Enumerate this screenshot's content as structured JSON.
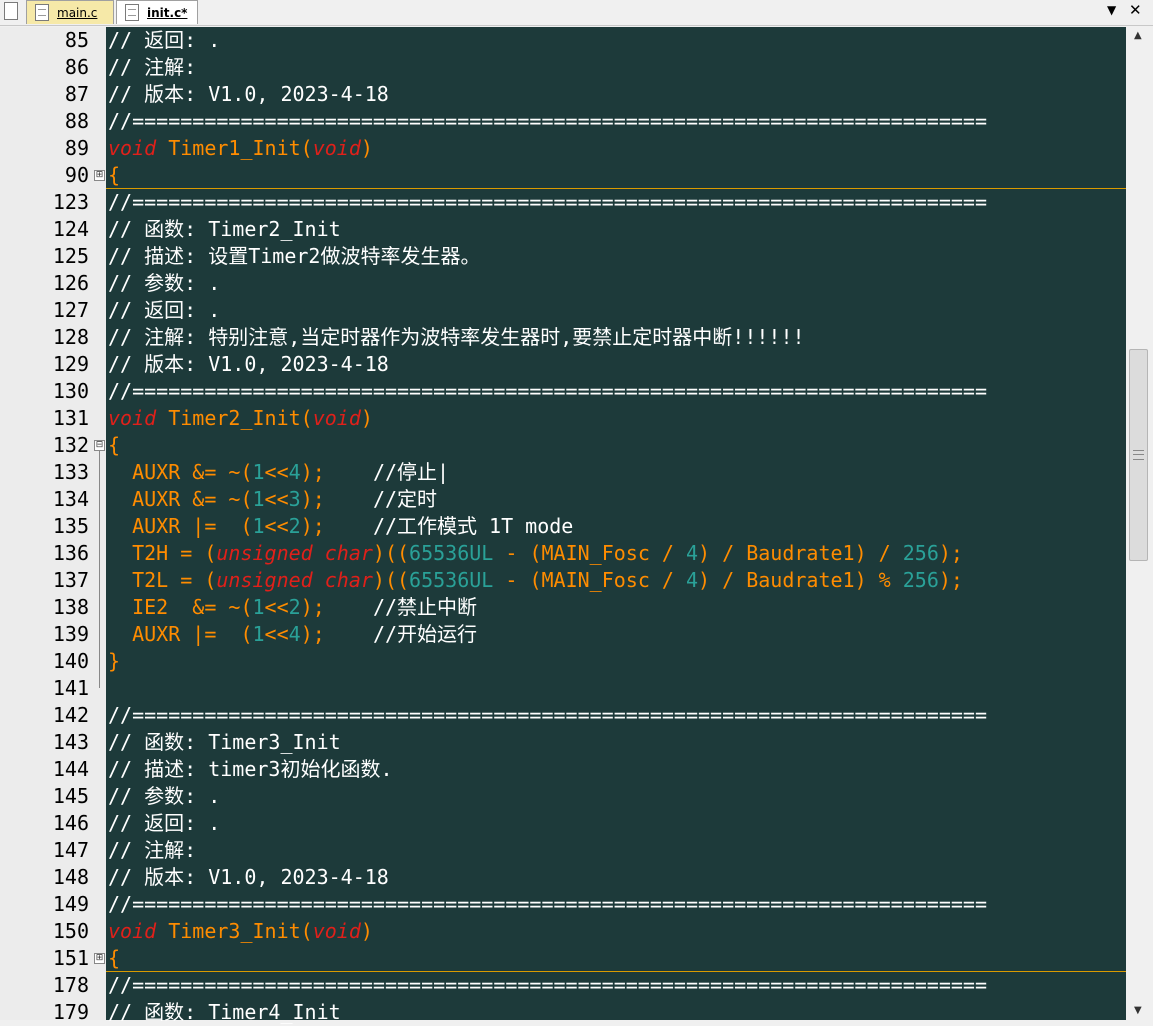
{
  "tabs": [
    {
      "label": "main.c"
    },
    {
      "label": "init.c*"
    }
  ],
  "icons": {
    "dropdown": "chevron-down-icon",
    "close": "close-icon",
    "file": "file-icon"
  },
  "glyphs": {
    "dropdown": "▼",
    "close": "✕",
    "fold_collapsed": "⊞",
    "fold_expanded": "⊟",
    "scroll_up": "▲",
    "scroll_down": "▼"
  },
  "colors": {
    "editor_bg": "#1d3a3a",
    "keyword": "#e0201a",
    "identifier": "#ff8c00",
    "number": "#2aa198",
    "comment": "#ffffff"
  },
  "code_lines": [
    {
      "n": "85",
      "tokens": [
        [
          "cm",
          "// 返回: ."
        ]
      ]
    },
    {
      "n": "86",
      "tokens": [
        [
          "cm",
          "// 注解:"
        ]
      ]
    },
    {
      "n": "87",
      "tokens": [
        [
          "cm",
          "// 版本: V1.0, 2023-4-18"
        ]
      ]
    },
    {
      "n": "88",
      "tokens": [
        [
          "cm",
          "//======================================================================="
        ]
      ]
    },
    {
      "n": "89",
      "tokens": [
        [
          "kw",
          "void"
        ],
        [
          "fn",
          " Timer1_Init("
        ],
        [
          "kw",
          "void"
        ],
        [
          "fn",
          ")"
        ]
      ]
    },
    {
      "n": "90",
      "fold": "collapsed",
      "sep_after": true,
      "tokens": [
        [
          "tx",
          "{"
        ]
      ]
    },
    {
      "n": "123",
      "tokens": [
        [
          "cm",
          "//======================================================================="
        ]
      ]
    },
    {
      "n": "124",
      "tokens": [
        [
          "cm",
          "// 函数: Timer2_Init"
        ]
      ]
    },
    {
      "n": "125",
      "tokens": [
        [
          "cm",
          "// 描述: 设置Timer2做波特率发生器。"
        ]
      ]
    },
    {
      "n": "126",
      "tokens": [
        [
          "cm",
          "// 参数: ."
        ]
      ]
    },
    {
      "n": "127",
      "tokens": [
        [
          "cm",
          "// 返回: ."
        ]
      ]
    },
    {
      "n": "128",
      "tokens": [
        [
          "cm",
          "// 注解: 特别注意,当定时器作为波特率发生器时,要禁止定时器中断!!!!!!"
        ]
      ]
    },
    {
      "n": "129",
      "tokens": [
        [
          "cm",
          "// 版本: V1.0, 2023-4-18"
        ]
      ]
    },
    {
      "n": "130",
      "tokens": [
        [
          "cm",
          "//======================================================================="
        ]
      ]
    },
    {
      "n": "131",
      "tokens": [
        [
          "kw",
          "void"
        ],
        [
          "fn",
          " Timer2_Init("
        ],
        [
          "kw",
          "void"
        ],
        [
          "fn",
          ")"
        ]
      ]
    },
    {
      "n": "132",
      "fold": "expanded",
      "tokens": [
        [
          "tx",
          "{"
        ]
      ]
    },
    {
      "n": "133",
      "tokens": [
        [
          "tx",
          "  AUXR &= ~("
        ],
        [
          "nm",
          "1"
        ],
        [
          "tx",
          "<<"
        ],
        [
          "nm",
          "4"
        ],
        [
          "tx",
          ");    "
        ],
        [
          "cm",
          "//停止|"
        ]
      ]
    },
    {
      "n": "134",
      "tokens": [
        [
          "tx",
          "  AUXR &= ~("
        ],
        [
          "nm",
          "1"
        ],
        [
          "tx",
          "<<"
        ],
        [
          "nm",
          "3"
        ],
        [
          "tx",
          ");    "
        ],
        [
          "cm",
          "//定时"
        ]
      ]
    },
    {
      "n": "135",
      "tokens": [
        [
          "tx",
          "  AUXR |=  ("
        ],
        [
          "nm",
          "1"
        ],
        [
          "tx",
          "<<"
        ],
        [
          "nm",
          "2"
        ],
        [
          "tx",
          ");    "
        ],
        [
          "cm",
          "//工作模式 1T mode"
        ]
      ]
    },
    {
      "n": "136",
      "tokens": [
        [
          "tx",
          "  T2H = ("
        ],
        [
          "kw",
          "unsigned char"
        ],
        [
          "tx",
          ")(("
        ],
        [
          "nm",
          "65536UL"
        ],
        [
          "tx",
          " - (MAIN_Fosc / "
        ],
        [
          "nm",
          "4"
        ],
        [
          "tx",
          ") / Baudrate1) / "
        ],
        [
          "nm",
          "256"
        ],
        [
          "tx",
          ");"
        ]
      ]
    },
    {
      "n": "137",
      "tokens": [
        [
          "tx",
          "  T2L = ("
        ],
        [
          "kw",
          "unsigned char"
        ],
        [
          "tx",
          ")(("
        ],
        [
          "nm",
          "65536UL"
        ],
        [
          "tx",
          " - (MAIN_Fosc / "
        ],
        [
          "nm",
          "4"
        ],
        [
          "tx",
          ") / Baudrate1) % "
        ],
        [
          "nm",
          "256"
        ],
        [
          "tx",
          ");"
        ]
      ]
    },
    {
      "n": "138",
      "tokens": [
        [
          "tx",
          "  IE2  &= ~("
        ],
        [
          "nm",
          "1"
        ],
        [
          "tx",
          "<<"
        ],
        [
          "nm",
          "2"
        ],
        [
          "tx",
          ");    "
        ],
        [
          "cm",
          "//禁止中断"
        ]
      ]
    },
    {
      "n": "139",
      "tokens": [
        [
          "tx",
          "  AUXR |=  ("
        ],
        [
          "nm",
          "1"
        ],
        [
          "tx",
          "<<"
        ],
        [
          "nm",
          "4"
        ],
        [
          "tx",
          ");    "
        ],
        [
          "cm",
          "//开始运行"
        ]
      ]
    },
    {
      "n": "140",
      "tokens": [
        [
          "tx",
          "}"
        ]
      ]
    },
    {
      "n": "141",
      "tokens": []
    },
    {
      "n": "142",
      "tokens": [
        [
          "cm",
          "//======================================================================="
        ]
      ]
    },
    {
      "n": "143",
      "tokens": [
        [
          "cm",
          "// 函数: Timer3_Init"
        ]
      ]
    },
    {
      "n": "144",
      "tokens": [
        [
          "cm",
          "// 描述: timer3初始化函数."
        ]
      ]
    },
    {
      "n": "145",
      "tokens": [
        [
          "cm",
          "// 参数: ."
        ]
      ]
    },
    {
      "n": "146",
      "tokens": [
        [
          "cm",
          "// 返回: ."
        ]
      ]
    },
    {
      "n": "147",
      "tokens": [
        [
          "cm",
          "// 注解:"
        ]
      ]
    },
    {
      "n": "148",
      "tokens": [
        [
          "cm",
          "// 版本: V1.0, 2023-4-18"
        ]
      ]
    },
    {
      "n": "149",
      "tokens": [
        [
          "cm",
          "//======================================================================="
        ]
      ]
    },
    {
      "n": "150",
      "tokens": [
        [
          "kw",
          "void"
        ],
        [
          "fn",
          " Timer3_Init("
        ],
        [
          "kw",
          "void"
        ],
        [
          "fn",
          ")"
        ]
      ]
    },
    {
      "n": "151",
      "fold": "collapsed",
      "sep_after": true,
      "tokens": [
        [
          "tx",
          "{"
        ]
      ]
    },
    {
      "n": "178",
      "tokens": [
        [
          "cm",
          "//======================================================================="
        ]
      ]
    },
    {
      "n": "179",
      "tokens": [
        [
          "cm",
          "// 函数: Timer4_Init"
        ]
      ]
    }
  ]
}
